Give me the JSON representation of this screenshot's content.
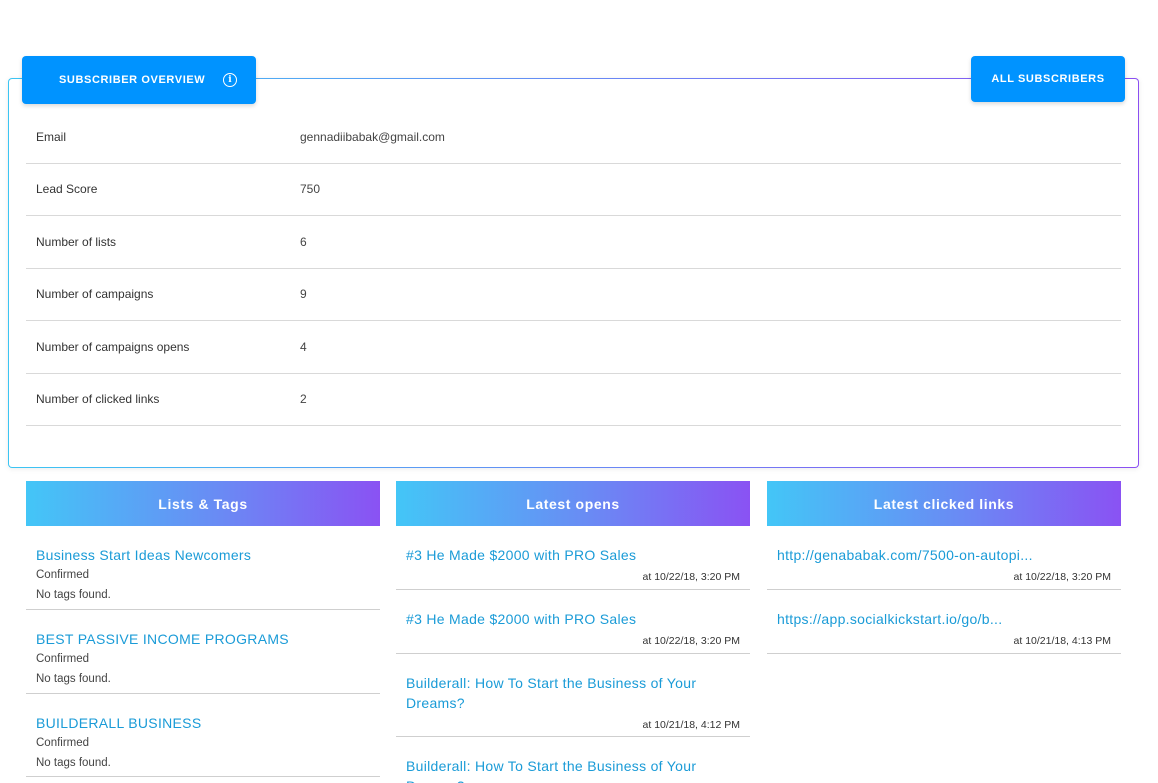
{
  "header": {
    "overview_label": "SUBSCRIBER OVERVIEW",
    "all_subscribers_label": "ALL SUBSCRIBERS",
    "info_icon": "info-icon"
  },
  "stats": [
    {
      "label": "Email",
      "value": "gennadiibabak@gmail.com"
    },
    {
      "label": "Lead Score",
      "value": "750"
    },
    {
      "label": "Number of lists",
      "value": "6"
    },
    {
      "label": "Number of campaigns",
      "value": "9"
    },
    {
      "label": "Number of campaigns opens",
      "value": "4"
    },
    {
      "label": "Number of clicked links",
      "value": "2"
    }
  ],
  "lists_tags": {
    "header": "Lists & Tags",
    "items": [
      {
        "name": "Business Start Ideas Newcomers",
        "status": "Confirmed",
        "tags": "No tags found."
      },
      {
        "name": "BEST PASSIVE INCOME PROGRAMS",
        "status": "Confirmed",
        "tags": "No tags found."
      },
      {
        "name": "BUILDERALL BUSINESS",
        "status": "Confirmed",
        "tags": "No tags found."
      }
    ]
  },
  "latest_opens": {
    "header": "Latest opens",
    "items": [
      {
        "title": "#3 He Made $2000 with PRO Sales",
        "time": "at 10/22/18, 3:20 PM"
      },
      {
        "title": "#3 He Made $2000 with PRO Sales",
        "time": "at 10/22/18, 3:20 PM"
      },
      {
        "title": "Builderall: How To Start the Business of Your Dreams?",
        "time": "at 10/21/18, 4:12 PM"
      },
      {
        "title": "Builderall: How To Start the Business of Your Dreams?",
        "time": ""
      }
    ]
  },
  "latest_clicked": {
    "header": "Latest clicked links",
    "items": [
      {
        "title": "http://genababak.com/7500-on-autopi...",
        "time": "at 10/22/18, 3:20 PM"
      },
      {
        "title": "https://app.socialkickstart.io/go/b...",
        "time": "at 10/21/18, 4:13 PM"
      }
    ]
  },
  "colors": {
    "accent": "#0093ff",
    "link": "#1a9bd7",
    "gradient_start": "#43c6f7",
    "gradient_end": "#8a52f3"
  }
}
